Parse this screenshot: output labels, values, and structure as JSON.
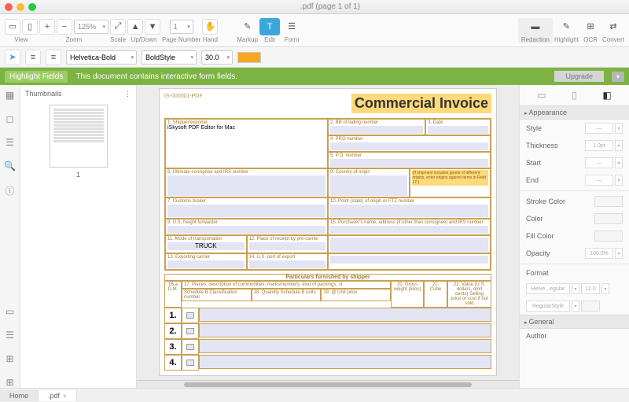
{
  "window": {
    "title": ".pdf (page 1 of 1)"
  },
  "toolbar": {
    "view_label": "View",
    "zoom_label": "Zoom",
    "zoom_value": "125%",
    "scale_label": "Scale",
    "updown_label": "Up/Down",
    "page_label": "Page Number",
    "page_value": "1",
    "hand_label": "Hand",
    "markup_label": "Markup",
    "edit_label": "Edit",
    "form_label": "Form",
    "redaction_label": "Redaction",
    "highlight_label": "Highlight",
    "ocr_label": "OCR",
    "convert_label": "Convert"
  },
  "subbar": {
    "font": "Helvetica-Bold",
    "style": "BoldStyle",
    "size": "30.0"
  },
  "banner": {
    "highlight": "Highlight Fields",
    "msg": "This document contains interactive form fields.",
    "upgrade": "Upgrade"
  },
  "thumbs": {
    "label": "Thumbnails",
    "page": "1"
  },
  "invoice": {
    "id": "IS-000001-PDF",
    "title": "Commercial Invoice",
    "f1": "1. Shipper/exporter",
    "f1_val": "iSkysoft PDF Editor for Mac",
    "f2": "2. Bill of lading number",
    "f3": "3. Date",
    "f4": "4. PRO number",
    "f5": "5. P.O. number",
    "f6": "6. Ultimate consignee and IRS number",
    "f9": "9. Country of origin",
    "note": "(If shipment includes goods of different origins, enter origins against items in Field 17.)",
    "f7": "7. Customs broker",
    "f10": "10. Point (state) of origin or FTZ number",
    "f8": "8. U.S. freight forwarder",
    "f15": "15. Purchaser's name, address (if other than consignee) and IRS number",
    "f11": "11. Mode of transportation",
    "f11_val": "TRUCK",
    "f12": "12. Place of receipt by pre-carrier",
    "f13": "13. Exporting carrier",
    "f14": "14. U.S. port of export",
    "partHdr": "Particulars furnished by shipper",
    "col_a": "16.a D.M.",
    "col_b": "17. Pieces, description of commodities, marks/numbers, kind of packings, sl.",
    "col_b1": "Schedule B Classification number",
    "col_b2": "18. Quantity Schedule B units",
    "col_b3": "19. @ Unit price",
    "col_c": "20. Gross weight (kilos)",
    "col_d": "21. Cube",
    "col_e": "22. Value (U.S. dollars, omit cents) Selling price or cost if not sold",
    "rows": [
      "1.",
      "2.",
      "3.",
      "4."
    ]
  },
  "props": {
    "appearance": "Appearance",
    "style": "Style",
    "thickness": "Thickness",
    "thickness_val": "1.0pt",
    "start": "Start",
    "end": "End",
    "stroke": "Stroke Color",
    "color": "Color",
    "fill": "Fill Color",
    "opacity": "Opacity",
    "opacity_val": "100.0%",
    "format": "Format",
    "font": "Helve...egular",
    "size": "12.0",
    "weight": "RegularStyle",
    "general": "General",
    "author": "Author"
  },
  "footer": {
    "home": "Home",
    "doc": ".pdf"
  }
}
